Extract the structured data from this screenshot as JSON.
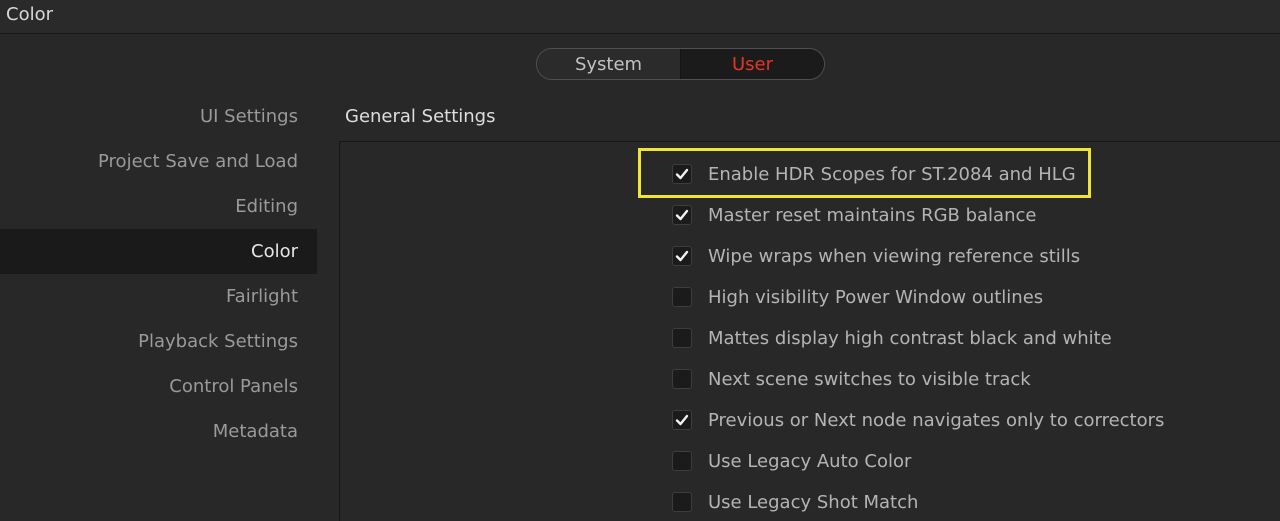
{
  "window": {
    "title": "Color"
  },
  "toggle": {
    "system_label": "System",
    "user_label": "User",
    "selected": "User",
    "active_color": "#e2362a"
  },
  "sidebar": {
    "items": [
      {
        "label": "UI Settings",
        "active": false
      },
      {
        "label": "Project Save and Load",
        "active": false
      },
      {
        "label": "Editing",
        "active": false
      },
      {
        "label": "Color",
        "active": true
      },
      {
        "label": "Fairlight",
        "active": false
      },
      {
        "label": "Playback Settings",
        "active": false
      },
      {
        "label": "Control Panels",
        "active": false
      },
      {
        "label": "Metadata",
        "active": false
      }
    ]
  },
  "main": {
    "section_title": "General Settings",
    "highlight_color": "#f1e534",
    "options": [
      {
        "label": "Enable HDR Scopes for ST.2084 and HLG",
        "checked": true,
        "highlighted": true
      },
      {
        "label": "Master reset maintains RGB balance",
        "checked": true,
        "highlighted": false
      },
      {
        "label": "Wipe wraps when viewing reference stills",
        "checked": true,
        "highlighted": false
      },
      {
        "label": "High visibility Power Window outlines",
        "checked": false,
        "highlighted": false
      },
      {
        "label": "Mattes display high contrast black and white",
        "checked": false,
        "highlighted": false
      },
      {
        "label": "Next scene switches to visible track",
        "checked": false,
        "highlighted": false
      },
      {
        "label": "Previous or Next node navigates only to correctors",
        "checked": true,
        "highlighted": false
      },
      {
        "label": "Use Legacy Auto Color",
        "checked": false,
        "highlighted": false
      },
      {
        "label": "Use Legacy Shot Match",
        "checked": false,
        "highlighted": false
      }
    ]
  }
}
